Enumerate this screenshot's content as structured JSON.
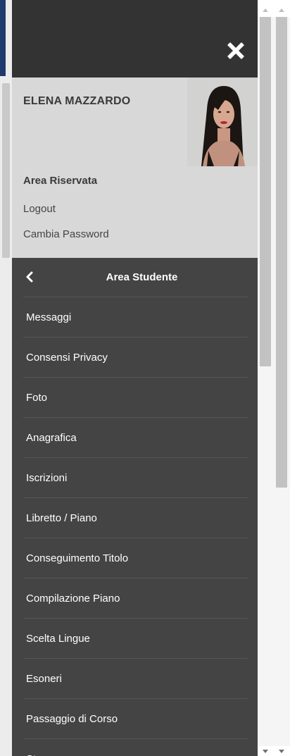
{
  "user": {
    "name": "ELENA MAZZARDO",
    "area_label": "Area Riservata",
    "logout_label": "Logout",
    "change_password_label": "Cambia Password"
  },
  "section": {
    "title": "Area Studente"
  },
  "menu": {
    "items": [
      {
        "label": "Messaggi"
      },
      {
        "label": "Consensi Privacy"
      },
      {
        "label": "Foto"
      },
      {
        "label": "Anagrafica"
      },
      {
        "label": "Iscrizioni"
      },
      {
        "label": "Libretto / Piano"
      },
      {
        "label": "Conseguimento Titolo"
      },
      {
        "label": "Compilazione Piano"
      },
      {
        "label": "Scelta Lingue"
      },
      {
        "label": "Esoneri"
      },
      {
        "label": "Passaggio di Corso"
      },
      {
        "label": "Stage"
      }
    ]
  },
  "icons": {
    "close": "close-icon",
    "back": "chevron-left-icon"
  },
  "colors": {
    "panel_bg": "#444444",
    "panel_top_bg": "#333333",
    "user_box_bg": "#d8d8d8",
    "accent_strip": "#1f3a6d"
  }
}
